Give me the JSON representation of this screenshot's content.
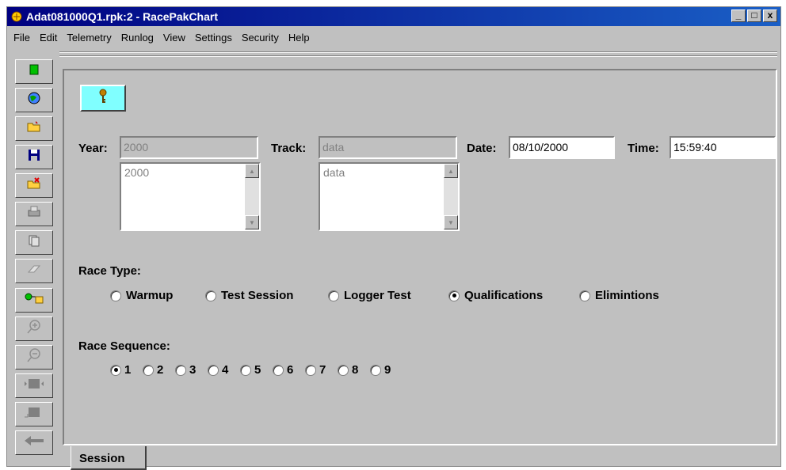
{
  "window": {
    "title": "Adat081000Q1.rpk:2 - RacePakChart",
    "buttons": {
      "minimize": "_",
      "maximize": "□",
      "close": "x"
    }
  },
  "menu": {
    "items": [
      "File",
      "Edit",
      "Telemetry",
      "Runlog",
      "View",
      "Settings",
      "Security",
      "Help"
    ]
  },
  "toolbar": {
    "icons": [
      "new-document-icon",
      "globe-icon",
      "open-folder-icon",
      "save-disk-icon",
      "close-folder-icon",
      "print-icon",
      "copy-icon",
      "eraser-icon",
      "link-icon",
      "zoom-in-icon",
      "zoom-out-icon",
      "scroll-left-icon",
      "scroll-right-icon",
      "back-arrow-icon"
    ]
  },
  "help_button": {
    "icon": "key-icon"
  },
  "form": {
    "year": {
      "label": "Year:",
      "value": "2000",
      "list": [
        "2000"
      ]
    },
    "track": {
      "label": "Track:",
      "value": "data",
      "list": [
        "data"
      ]
    },
    "date": {
      "label": "Date:",
      "value": "08/10/2000"
    },
    "time": {
      "label": "Time:",
      "value": "15:59:40"
    },
    "race_type": {
      "label": "Race Type:",
      "options": [
        "Warmup",
        "Test Session",
        "Logger Test",
        "Qualifications",
        "Elimintions"
      ],
      "selected": "Qualifications"
    },
    "race_sequence": {
      "label": "Race Sequence:",
      "options": [
        "1",
        "2",
        "3",
        "4",
        "5",
        "6",
        "7",
        "8",
        "9"
      ],
      "selected": "1"
    }
  },
  "tabs": [
    {
      "label": "Session"
    }
  ],
  "colors": {
    "titlebar": "#000080",
    "face": "#c0c0c0",
    "help_button": "#80ffff"
  }
}
